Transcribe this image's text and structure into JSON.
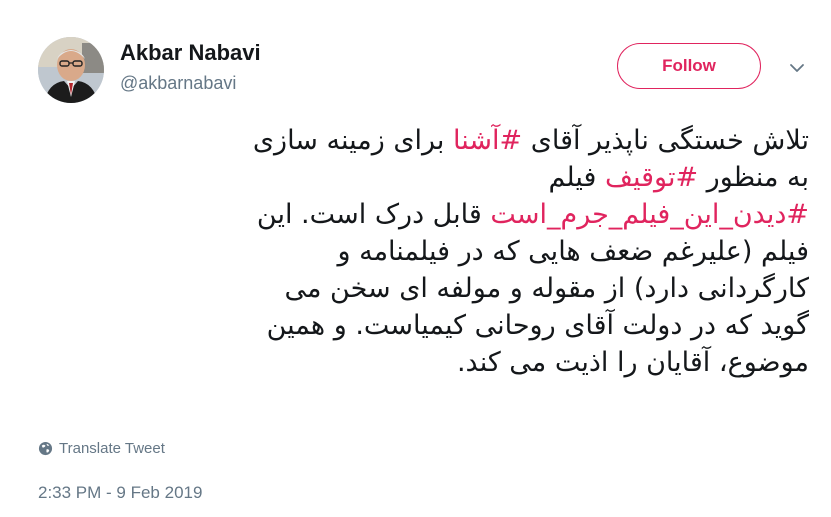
{
  "author": {
    "name": "Akbar Nabavi",
    "handle": "@akbarnabavi"
  },
  "follow_label": "Follow",
  "tweet": {
    "lines": [
      [
        {
          "text": "تلاش خستگی ناپذیر آقای "
        },
        {
          "text": "#آشنا",
          "tag": true
        },
        {
          "text": " برای زمینه سازی"
        }
      ],
      [
        {
          "text": "به منظور "
        },
        {
          "text": "#توقیف",
          "tag": true
        },
        {
          "text": " فیلم"
        }
      ],
      [
        {
          "text": "#دیدن_این_فیلم_جرم_است",
          "tag": true
        },
        {
          "text": " قابل درک است. این"
        }
      ],
      [
        {
          "text": "فیلم (علیرغم ضعف هایی که در فیلمنامه و"
        }
      ],
      [
        {
          "text": "کارگردانی دارد) از مقوله و مولفه ای سخن می"
        }
      ],
      [
        {
          "text": "گوید که در دولت آقای روحانی کیمیاست. و همین"
        }
      ],
      [
        {
          "text": "موضوع، آقایان را اذیت می کند."
        }
      ]
    ]
  },
  "translate_label": "Translate Tweet",
  "timestamp": "2:33 PM - 9 Feb 2019",
  "colors": {
    "accent": "#e0245e",
    "text": "#14171a",
    "secondary": "#657786"
  },
  "icons": {
    "avatar": "avatar",
    "caret": "chevron-down-icon",
    "translate": "globe-icon"
  }
}
